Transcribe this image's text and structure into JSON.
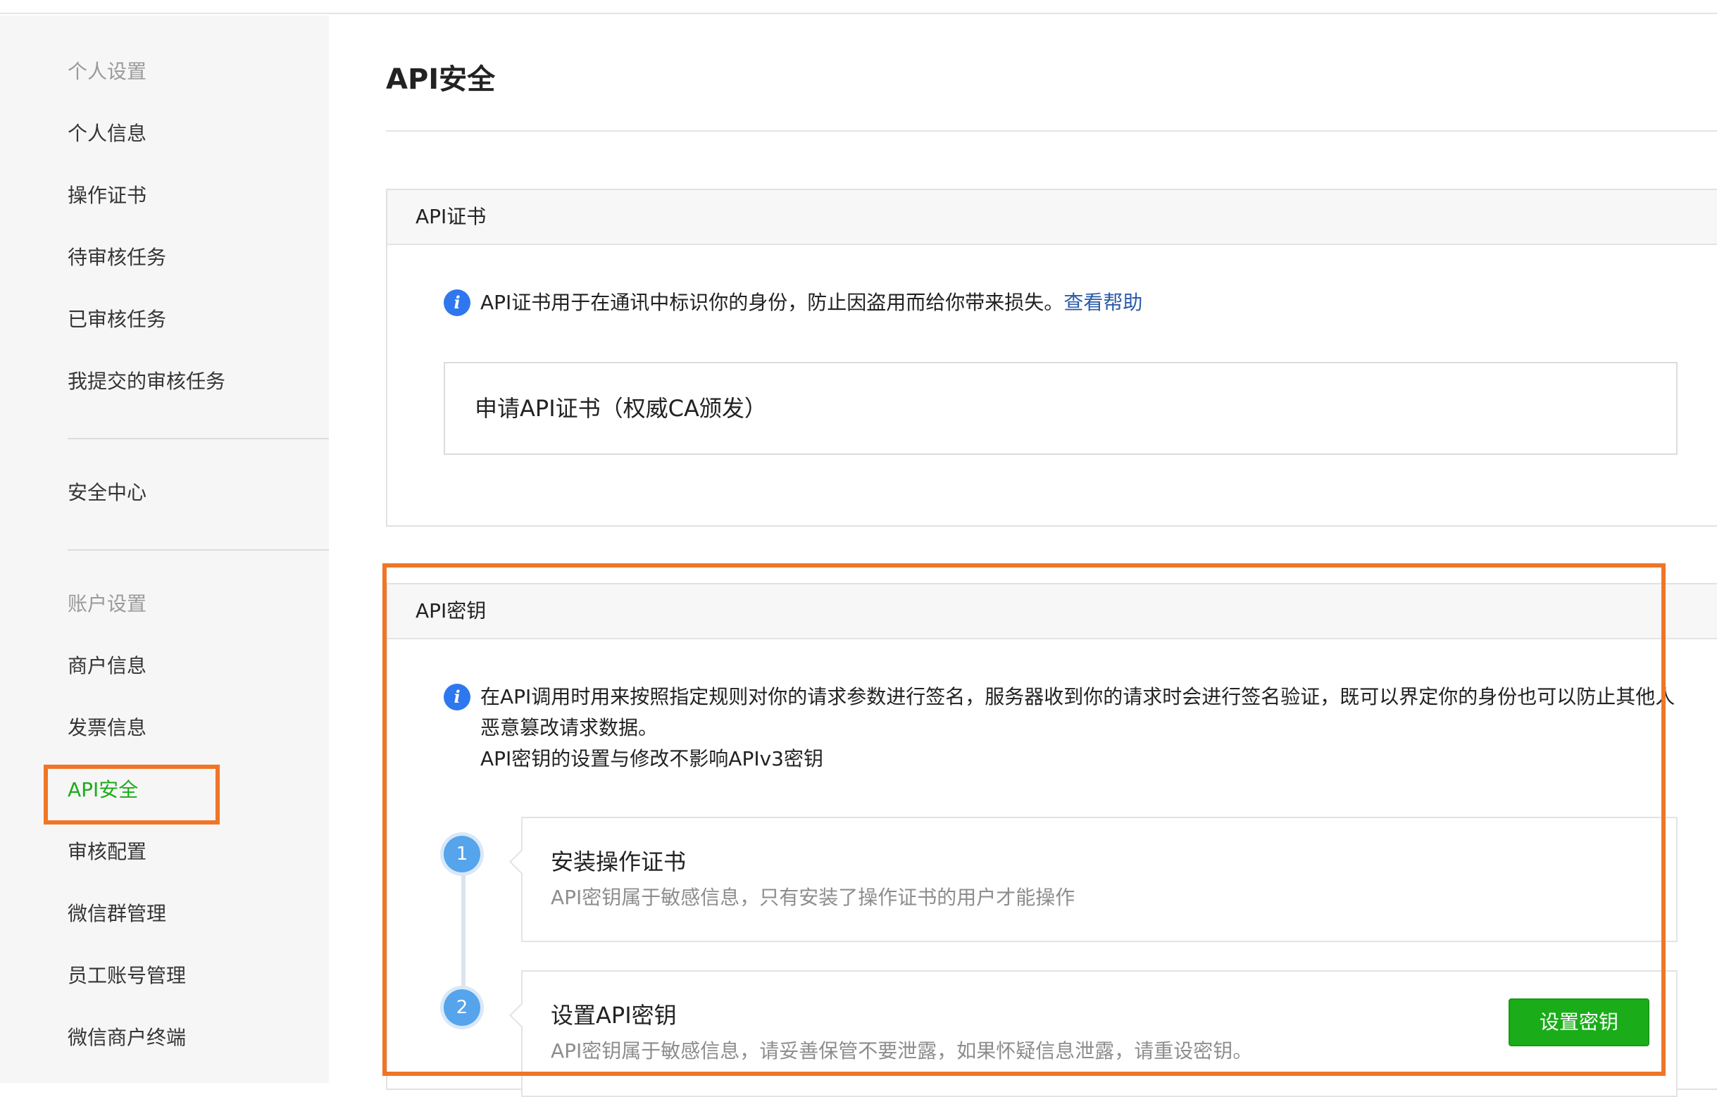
{
  "sidebar": {
    "personal_header": "个人设置",
    "personal_items": [
      "个人信息",
      "操作证书",
      "待审核任务",
      "已审核任务",
      "我提交的审核任务"
    ],
    "security_center": "安全中心",
    "account_header": "账户设置",
    "account_items": [
      "商户信息",
      "发票信息",
      "API安全",
      "审核配置",
      "微信群管理",
      "员工账号管理",
      "微信商户终端"
    ],
    "active_item": "API安全"
  },
  "main": {
    "page_title": "API安全",
    "api_cert": {
      "header": "API证书",
      "info_text": "API证书用于在通讯中标识你的身份，防止因盗用而给你带来损失。",
      "help_link": "查看帮助",
      "apply_label": "申请API证书（权威CA颁发）"
    },
    "api_key": {
      "header": "API密钥",
      "info_lines": [
        "在API调用时用来按照指定规则对你的请求参数进行签名，服务器收到你的请求时会进行签名验证，既可以界定你的身份也可以防止其他人",
        "恶意篡改请求数据。",
        "API密钥的设置与修改不影响APIv3密钥"
      ],
      "steps": [
        {
          "number": "1",
          "title": "安装操作证书",
          "desc": "API密钥属于敏感信息，只有安装了操作证书的用户才能操作"
        },
        {
          "number": "2",
          "title": "设置API密钥",
          "desc": "API密钥属于敏感信息，请妥善保管不要泄露，如果怀疑信息泄露，请重设密钥。",
          "button": "设置密钥"
        }
      ]
    }
  },
  "colors": {
    "accent_green": "#1aad19",
    "highlight_orange": "#f07527",
    "info_blue": "#2f77ef",
    "step_blue": "#55a4ec",
    "link_blue": "#2b5ba8"
  },
  "icons": [
    "info-icon"
  ]
}
